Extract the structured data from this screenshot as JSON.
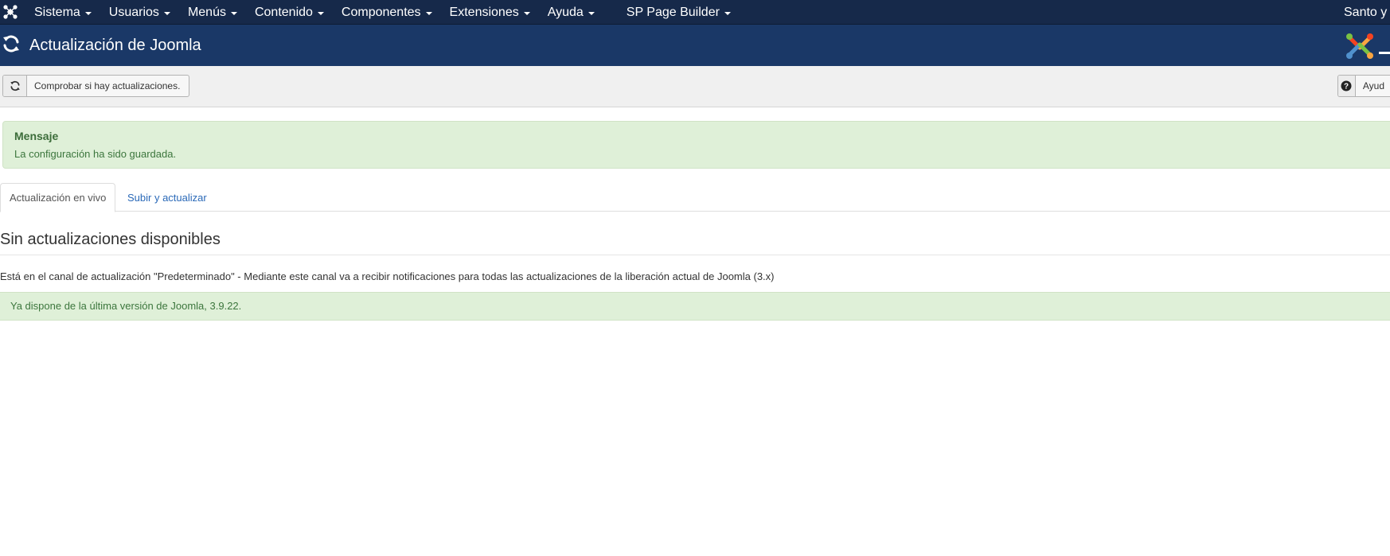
{
  "navbar": {
    "logo_icon": "joomla-icon",
    "menu": [
      {
        "label": "Sistema"
      },
      {
        "label": "Usuarios"
      },
      {
        "label": "Menús"
      },
      {
        "label": "Contenido"
      },
      {
        "label": "Componentes"
      },
      {
        "label": "Extensiones"
      },
      {
        "label": "Ayuda"
      },
      {
        "label": "SP Page Builder"
      }
    ],
    "user": "Santo y"
  },
  "header": {
    "icon": "refresh-icon",
    "title": "Actualización de Joomla",
    "logo": "joomla-logo"
  },
  "toolbar": {
    "check_icon": "refresh-icon",
    "check_label": "Comprobar si hay actualizaciones.",
    "help_icon": "question-circle-icon",
    "help_label": "Ayud"
  },
  "message": {
    "heading": "Mensaje",
    "text": "La configuración ha sido guardada."
  },
  "tabs": [
    {
      "label": "Actualización en vivo",
      "active": true
    },
    {
      "label": "Subir y actualizar",
      "active": false
    }
  ],
  "content": {
    "title": "Sin actualizaciones disponibles",
    "channel_text": "Está en el canal de actualización \"Predeterminado\" - Mediante este canal va a recibir notificaciones para todas las actualizaciones de la liberación actual de Joomla (3.x)",
    "status_text": "Ya dispone de la última versión de Joomla, 3.9.22."
  },
  "colors": {
    "navbar_bg": "#16294a",
    "header_bg": "#1a3867",
    "alert_success_bg": "#dff0d8",
    "alert_success_text": "#3c763d",
    "link": "#2a69b8"
  }
}
